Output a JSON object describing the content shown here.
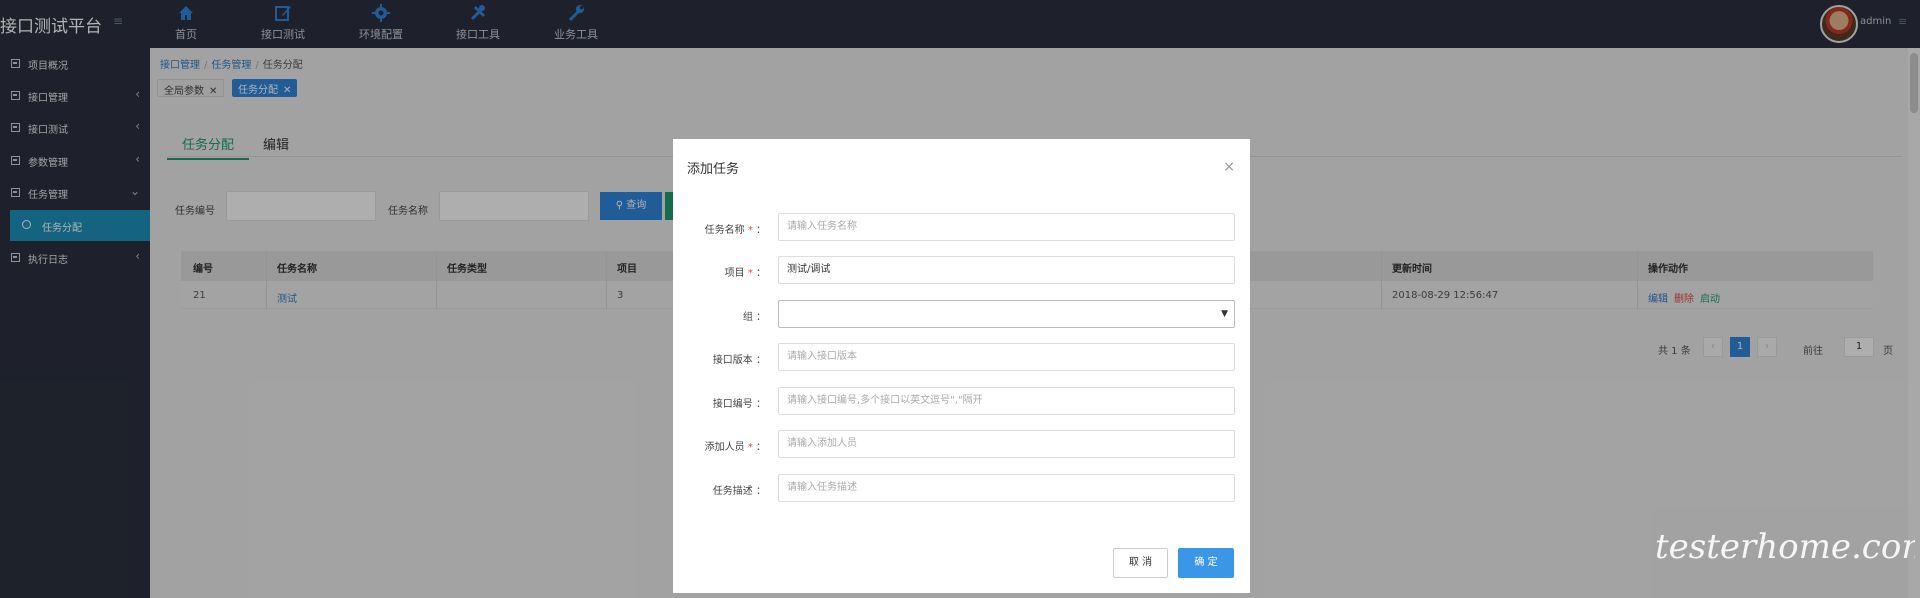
{
  "app": {
    "title": "接口测试平台",
    "toggle": "≡"
  },
  "topnav": [
    {
      "label": "首页",
      "icon": "home-icon"
    },
    {
      "label": "接口测试",
      "icon": "edit-icon"
    },
    {
      "label": "环境配置",
      "icon": "gear-icon"
    },
    {
      "label": "接口工具",
      "icon": "tools-icon"
    },
    {
      "label": "业务工具",
      "icon": "wrench-icon"
    }
  ],
  "user": {
    "name": "admin",
    "menu": "≡"
  },
  "sidebar": {
    "items": [
      {
        "label": "项目概况",
        "chev": ""
      },
      {
        "label": "接口管理",
        "chev": "‹"
      },
      {
        "label": "接口测试",
        "chev": "‹"
      },
      {
        "label": "参数管理",
        "chev": "‹"
      },
      {
        "label": "任务管理",
        "chev": "⌄"
      },
      {
        "label": "执行日志",
        "chev": "‹"
      }
    ],
    "sub": {
      "label": "任务分配"
    }
  },
  "breadcrumb": {
    "a": "接口管理",
    "b": "任务管理",
    "c": "任务分配",
    "sep": "/"
  },
  "tags": {
    "global": "全局参数",
    "active": "任务分配",
    "x": "✕"
  },
  "tabs": {
    "active": "任务分配",
    "other": "编辑"
  },
  "search": {
    "no_label": "任务编号",
    "name_label": "任务名称",
    "button": "查询"
  },
  "table": {
    "headers": [
      "编号",
      "任务名称",
      "任务类型",
      "项目",
      "更新时间",
      "操作动作"
    ],
    "row": {
      "id": "21",
      "name": "测试",
      "type": "",
      "project": "3",
      "updated": "2018-08-29 12:56:47"
    },
    "actions": {
      "edit": "编辑",
      "delete": "删除",
      "start": "启动"
    }
  },
  "pager": {
    "total": "共 1 条",
    "prev": "‹",
    "current": "1",
    "next": "›",
    "goto": "前往",
    "page_input": "1",
    "page_unit": "页"
  },
  "modal": {
    "title": "添加任务",
    "close": "×",
    "fields": [
      {
        "label": "任务名称",
        "required": "*",
        "placeholder": "请输入任务名称",
        "value": ""
      },
      {
        "label": "项目",
        "required": "*",
        "placeholder": "",
        "value": "测试/调试"
      },
      {
        "label": "组",
        "required": "",
        "placeholder": "",
        "value": ""
      },
      {
        "label": "接口版本",
        "required": "",
        "placeholder": "请输入接口版本",
        "value": ""
      },
      {
        "label": "接口编号",
        "required": "",
        "placeholder": "请输入接口编号,多个接口以英文逗号\",\"隔开",
        "value": ""
      },
      {
        "label": "添加人员",
        "required": "*",
        "placeholder": "请输入添加人员",
        "value": ""
      },
      {
        "label": "任务描述",
        "required": "",
        "placeholder": "请输入任务描述",
        "value": ""
      }
    ],
    "cancel": "取 消",
    "ok": "确 定"
  },
  "watermark": "testerhome.com"
}
